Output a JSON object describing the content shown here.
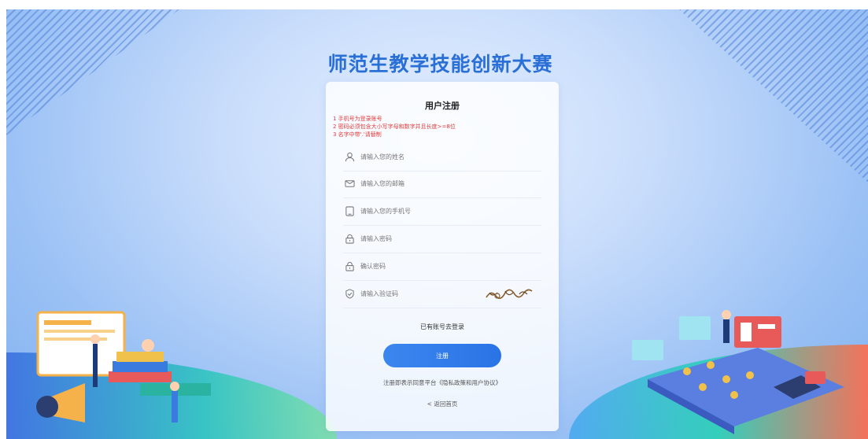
{
  "page": {
    "title": "师范生教学技能创新大赛"
  },
  "form": {
    "title": "用户注册",
    "notes": [
      "1 手机号为登录账号",
      "2 密码必须包含大小写字母和数字并且长度>=8位",
      "3 名字中带'.'请替制"
    ],
    "fields": [
      {
        "icon": "user-icon",
        "placeholder": "请输入您的姓名"
      },
      {
        "icon": "mail-icon",
        "placeholder": "请输入您的邮箱"
      },
      {
        "icon": "phone-icon",
        "placeholder": "请输入您的手机号"
      },
      {
        "icon": "lock-icon",
        "placeholder": "请输入密码"
      },
      {
        "icon": "lock-icon",
        "placeholder": "确认密码"
      },
      {
        "icon": "shield-check-icon",
        "placeholder": "请输入验证码"
      }
    ],
    "login_link": "已有账号去登录",
    "submit_label": "注册",
    "agreement": "注册即表示同意平台《隐私政策和用户协议》",
    "back_link": "< 返回首页"
  },
  "colors": {
    "accent": "#2a73e6",
    "title": "#2a6fd6",
    "note": "#e23b3b"
  }
}
